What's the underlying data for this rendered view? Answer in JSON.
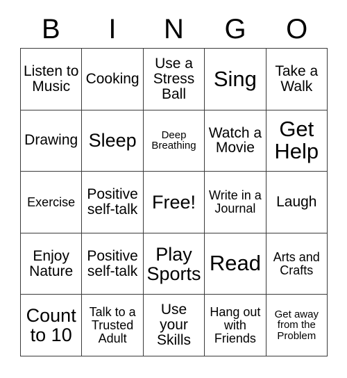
{
  "card": {
    "type": "bingo-card",
    "columns": 5,
    "rows": 5,
    "border_color": "#3a3a3a",
    "background_color": "#ffffff",
    "text_color": "#000000"
  },
  "header": {
    "letters": [
      "B",
      "I",
      "N",
      "G",
      "O"
    ]
  },
  "grid": {
    "cells": [
      {
        "text": "Listen to Music",
        "size": "md"
      },
      {
        "text": "Cooking",
        "size": "md"
      },
      {
        "text": "Use a Stress Ball",
        "size": "md"
      },
      {
        "text": "Sing",
        "size": "xl"
      },
      {
        "text": "Take a Walk",
        "size": "md"
      },
      {
        "text": "Drawing",
        "size": "md"
      },
      {
        "text": "Sleep",
        "size": "lg"
      },
      {
        "text": "Deep Breathing",
        "size": "xs"
      },
      {
        "text": "Watch a Movie",
        "size": "md"
      },
      {
        "text": "Get Help",
        "size": "xl"
      },
      {
        "text": "Exercise",
        "size": "sm"
      },
      {
        "text": "Positive self-talk",
        "size": "md"
      },
      {
        "text": "Free!",
        "size": "lg"
      },
      {
        "text": "Write in a Journal",
        "size": "sm"
      },
      {
        "text": "Laugh",
        "size": "md"
      },
      {
        "text": "Enjoy Nature",
        "size": "md"
      },
      {
        "text": "Positive self-talk",
        "size": "md"
      },
      {
        "text": "Play Sports",
        "size": "lg"
      },
      {
        "text": "Read",
        "size": "xl"
      },
      {
        "text": "Arts and Crafts",
        "size": "sm"
      },
      {
        "text": "Count to 10",
        "size": "lg"
      },
      {
        "text": "Talk to a Trusted Adult",
        "size": "sm"
      },
      {
        "text": "Use your Skills",
        "size": "md"
      },
      {
        "text": "Hang out with Friends",
        "size": "sm"
      },
      {
        "text": "Get away from the Problem",
        "size": "xs"
      }
    ]
  }
}
